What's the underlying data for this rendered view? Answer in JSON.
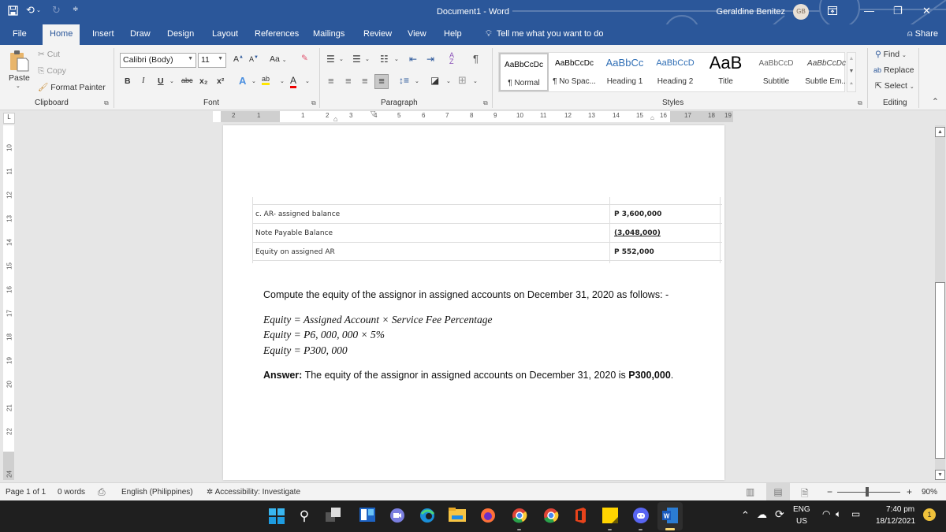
{
  "titlebar": {
    "doc_title": "Document1  -  Word",
    "user_name": "Geraldine Benitez",
    "user_initials": "GB",
    "icons": [
      "save-icon",
      "undo-icon",
      "redo-icon",
      "customize-qat-icon",
      "ribbon-display-icon",
      "minimize-icon",
      "restore-icon",
      "close-icon"
    ]
  },
  "tabs": [
    {
      "label": "File"
    },
    {
      "label": "Home",
      "active": true
    },
    {
      "label": "Insert"
    },
    {
      "label": "Draw"
    },
    {
      "label": "Design"
    },
    {
      "label": "Layout"
    },
    {
      "label": "References"
    },
    {
      "label": "Mailings"
    },
    {
      "label": "Review"
    },
    {
      "label": "View"
    },
    {
      "label": "Help"
    }
  ],
  "tell_me": "Tell me what you want to do",
  "share": "Share",
  "ribbon": {
    "clipboard": {
      "label": "Clipboard",
      "paste": "Paste",
      "cut": "Cut",
      "copy": "Copy",
      "format_painter": "Format Painter"
    },
    "font": {
      "label": "Font",
      "font_name": "Calibri (Body)",
      "font_size": "11",
      "change_case": "Aa",
      "bold": "B",
      "italic": "I",
      "underline": "U",
      "strike": "abc",
      "subscript": "x₂",
      "superscript": "x²"
    },
    "paragraph": {
      "label": "Paragraph"
    },
    "styles": {
      "label": "Styles",
      "items": [
        {
          "preview": "AaBbCcDc",
          "name": "¶ Normal"
        },
        {
          "preview": "AaBbCcDc",
          "name": "¶ No Spac..."
        },
        {
          "preview": "AaBbCc",
          "name": "Heading 1"
        },
        {
          "preview": "AaBbCcD",
          "name": "Heading 2"
        },
        {
          "preview": "AaB",
          "name": "Title"
        },
        {
          "preview": "AaBbCcD",
          "name": "Subtitle"
        },
        {
          "preview": "AaBbCcDc",
          "name": "Subtle Em..."
        }
      ]
    },
    "editing": {
      "label": "Editing",
      "find": "Find",
      "replace": "Replace",
      "select": "Select"
    }
  },
  "ruler": {
    "h_numbers": [
      "2",
      "1",
      "1",
      "2",
      "3",
      "4",
      "5",
      "6",
      "7",
      "8",
      "9",
      "10",
      "11",
      "12",
      "13",
      "14",
      "15",
      "16",
      "17",
      "18",
      "19"
    ],
    "v_numbers": [
      "10",
      "11",
      "12",
      "13",
      "14",
      "15",
      "16",
      "17",
      "18",
      "19",
      "20",
      "21",
      "22",
      "24"
    ],
    "corner": "L"
  },
  "document": {
    "table": [
      {
        "label": "c. AR- assigned balance",
        "value": "P 3,600,000"
      },
      {
        "label": "Note Payable Balance",
        "value": "(3,048,000)"
      },
      {
        "label": "Equity on assigned AR",
        "value": "P 552,000"
      }
    ],
    "intro": "Compute the equity of the assignor in assigned accounts on December 31, 2020 as follows: -",
    "equations": [
      {
        "lhs": "Equity",
        "rhs": "= Assigned Account  × Service Fee Percentage"
      },
      {
        "lhs": "Equity",
        "rhs": "= P6, 000, 000  × 5%"
      },
      {
        "lhs": "Equity",
        "rhs": "= P300, 000"
      }
    ],
    "answer_label": "Answer:",
    "answer_text": " The equity of the assignor in assigned accounts on December 31, 2020 is ",
    "answer_value": "P300,000",
    "answer_end": "."
  },
  "statusbar": {
    "page": "Page 1 of 1",
    "words": "0 words",
    "language": "English (Philippines)",
    "accessibility": "Accessibility: Investigate",
    "zoom_minus": "−",
    "zoom_plus": "+",
    "zoom_level": "90%",
    "zoom_percent": 90
  },
  "taskbar": {
    "apps": [
      "start",
      "search",
      "task-view",
      "widgets",
      "teams-chat",
      "edge",
      "file-explorer",
      "firefox",
      "chrome-profile-1",
      "chrome-profile-2",
      "office",
      "sticky-notes",
      "discord",
      "word"
    ],
    "language_top": "ENG",
    "language_bottom": "US",
    "time": "7:40 pm",
    "date": "18/12/2021",
    "notification_count": "1"
  },
  "colors": {
    "word_blue": "#2b579a",
    "ribbon_bg": "#f3f3f3",
    "taskbar_bg": "#1f1f1f"
  }
}
